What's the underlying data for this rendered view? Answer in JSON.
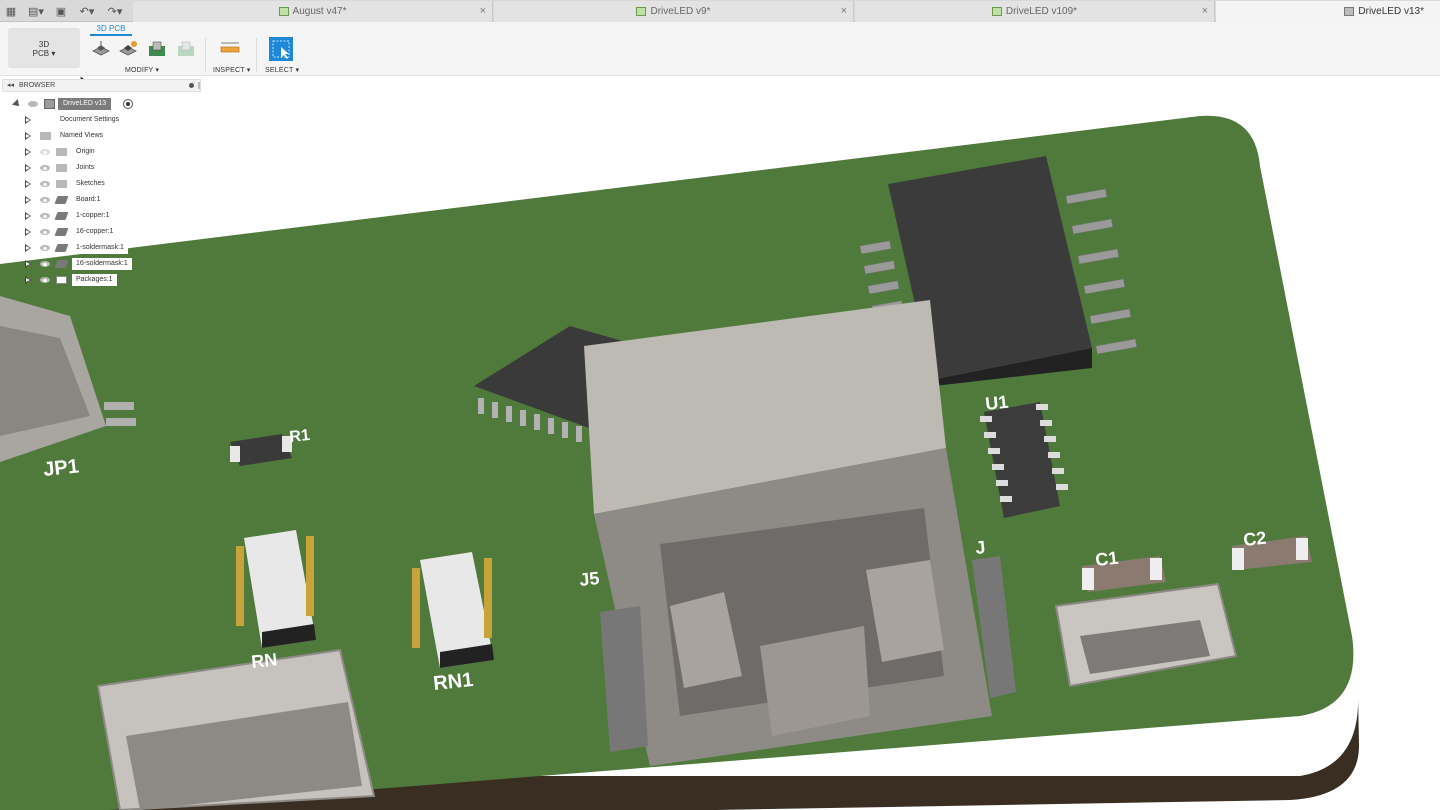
{
  "tabs": [
    {
      "label": "August v47*",
      "close": "×",
      "active": false
    },
    {
      "label": "DriveLED v9*",
      "close": "×",
      "active": false
    },
    {
      "label": "DriveLED v109*",
      "close": "×",
      "active": false
    },
    {
      "label": "DriveLED v13*",
      "close": "",
      "active": true
    }
  ],
  "toolbar": {
    "workspace_label_line1": "3D",
    "workspace_label_line2": "PCB",
    "workspace_tab": "3D PCB",
    "groups": [
      "MODIFY ▾",
      "INSPECT ▾",
      "SELECT ▾"
    ]
  },
  "browser": {
    "title": "BROWSER",
    "root": "DriveLED v13",
    "items": [
      {
        "label": "Document Settings",
        "icon": "gear-icon"
      },
      {
        "label": "Named Views",
        "icon": "folder-icon"
      },
      {
        "label": "Origin",
        "icon": "folder-icon"
      },
      {
        "label": "Joints",
        "icon": "folder-icon"
      },
      {
        "label": "Sketches",
        "icon": "folder-icon"
      },
      {
        "label": "Board:1",
        "icon": "layer-icon"
      },
      {
        "label": "1-copper:1",
        "icon": "layer-icon"
      },
      {
        "label": "16-copper:1",
        "icon": "layer-icon"
      },
      {
        "label": "1-soldermask:1",
        "icon": "layer-icon"
      },
      {
        "label": "16-soldermask:1",
        "icon": "layer-icon"
      },
      {
        "label": "Packages:1",
        "icon": "package-icon"
      }
    ]
  },
  "board_labels": {
    "jp1": "JP1",
    "rn1": "RN1",
    "rn2": "RN",
    "u1": "U1",
    "j5": "J5",
    "c1": "C1",
    "c2": "C2",
    "r1": "R1",
    "j_side": "J"
  },
  "colors": {
    "board": "#4f7a3c",
    "board_edge": "#3a2e22",
    "ic_body": "#3b3b3b",
    "connector": "#c8c4be",
    "accent": "#1e88d8"
  }
}
